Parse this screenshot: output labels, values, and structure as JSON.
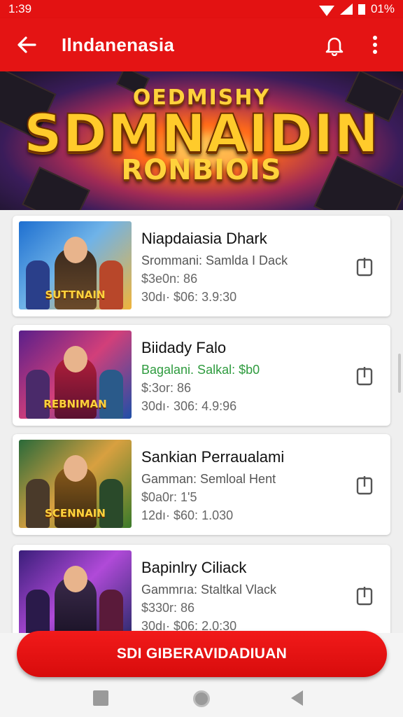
{
  "status_bar": {
    "time": "1:39",
    "battery": "01%"
  },
  "app_bar": {
    "title": "Ilndanenasia",
    "back_icon": "arrow-left-icon",
    "search_icon": "bell-icon",
    "more_icon": "more-vert-icon"
  },
  "banner": {
    "line1": "OEDMISHY",
    "line2": "SDMNAIDIN",
    "line3": "RONBIOIS"
  },
  "items": [
    {
      "title": "Niapdaiasia Dhark",
      "line1": "Srommani: Samlda I Dack",
      "line2": "$3e0n: 86",
      "line3": "30dı· $06: 3.9:30",
      "thumb_logo": "SUTTNAIN",
      "line1_color": "gray"
    },
    {
      "title": "Biidady Falo",
      "line1": "Bagalani. Salkal: $b0",
      "line2": "$:3or: 86",
      "line3": "30dı· 306: 4.9:96",
      "thumb_logo": "REBNIMAN",
      "line1_color": "green"
    },
    {
      "title": "Sankian Perraualami",
      "line1": "Gamman: Semloal Hent",
      "line2": "$0a0r: 1'5",
      "line3": "12dı· $60: 1.030",
      "thumb_logo": "SCENNAIN",
      "line1_color": "gray"
    },
    {
      "title": "Bapinlry Ciliack",
      "line1": "Gammrıa: Staltkal Vlack",
      "line2": "$330r: 86",
      "line3": "30dı· $06: 2.0:30",
      "thumb_logo": "",
      "line1_color": "gray"
    }
  ],
  "cta": {
    "label": "SDI GIBERAVIDADIUAN"
  },
  "colors": {
    "primary": "#e41414",
    "green": "#2e9b3e"
  }
}
